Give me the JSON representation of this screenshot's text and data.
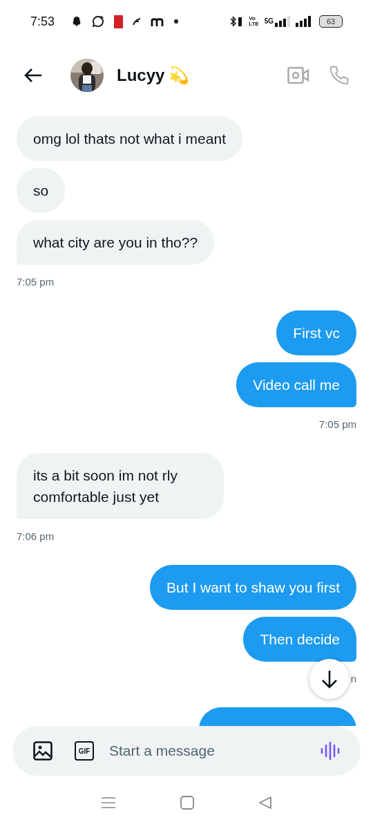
{
  "status_bar": {
    "time": "7:53",
    "volte": [
      "Vo",
      "LTE"
    ],
    "network": "5G",
    "battery": "63"
  },
  "header": {
    "name": "Lucyy",
    "emoji": "💫"
  },
  "groups": [
    {
      "outgoing": false,
      "messages": [
        "omg lol thats not what i meant",
        "so",
        "what city are you in tho??"
      ],
      "time": "7:05 pm"
    },
    {
      "outgoing": true,
      "messages": [
        "First vc",
        "Video call me"
      ],
      "time": "7:05 pm"
    },
    {
      "outgoing": false,
      "messages": [
        "its a bit soon im not rly comfortable just yet"
      ],
      "time": "7:06 pm"
    },
    {
      "outgoing": true,
      "messages": [
        "But I want to shaw you first",
        "Then decide"
      ],
      "time": "n"
    }
  ],
  "partial_bubble": {
    "outgoing": true
  },
  "composer": {
    "gif_label": "GIF",
    "placeholder": "Start a message"
  }
}
